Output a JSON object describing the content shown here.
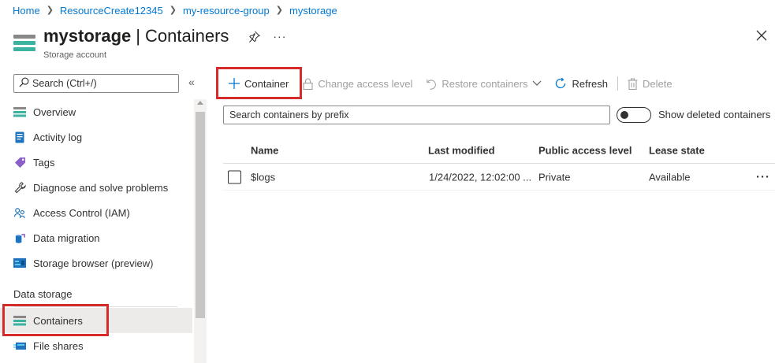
{
  "breadcrumb": [
    "Home",
    "ResourceCreate12345",
    "my-resource-group",
    "mystorage"
  ],
  "header": {
    "title": "mystorage",
    "separator": "|",
    "section": "Containers",
    "subtitle": "Storage account"
  },
  "sidebar": {
    "search_placeholder": "Search (Ctrl+/)",
    "collapse_glyph": "«",
    "items": [
      {
        "label": "Overview",
        "icon": "storage-overview-icon"
      },
      {
        "label": "Activity log",
        "icon": "activity-log-icon"
      },
      {
        "label": "Tags",
        "icon": "tag-icon"
      },
      {
        "label": "Diagnose and solve problems",
        "icon": "wrench-icon"
      },
      {
        "label": "Access Control (IAM)",
        "icon": "people-icon"
      },
      {
        "label": "Data migration",
        "icon": "data-migration-icon"
      },
      {
        "label": "Storage browser (preview)",
        "icon": "storage-browser-icon"
      }
    ],
    "section_label": "Data storage",
    "storage_items": [
      {
        "label": "Containers",
        "icon": "containers-icon",
        "active": true
      },
      {
        "label": "File shares",
        "icon": "file-shares-icon"
      }
    ]
  },
  "toolbar": {
    "container_label": "Container",
    "change_access_label": "Change access level",
    "restore_label": "Restore containers",
    "refresh_label": "Refresh",
    "delete_label": "Delete"
  },
  "filter": {
    "placeholder": "Search containers by prefix",
    "show_deleted_label": "Show deleted containers"
  },
  "table": {
    "columns": [
      "Name",
      "Last modified",
      "Public access level",
      "Lease state"
    ],
    "rows": [
      {
        "name": "$logs",
        "last_modified": "1/24/2022, 12:02:00 ...",
        "access": "Private",
        "lease": "Available"
      }
    ]
  },
  "colors": {
    "link": "#0078d4",
    "highlight": "#d52b2b",
    "storage_teal": "#3bb3a0"
  }
}
